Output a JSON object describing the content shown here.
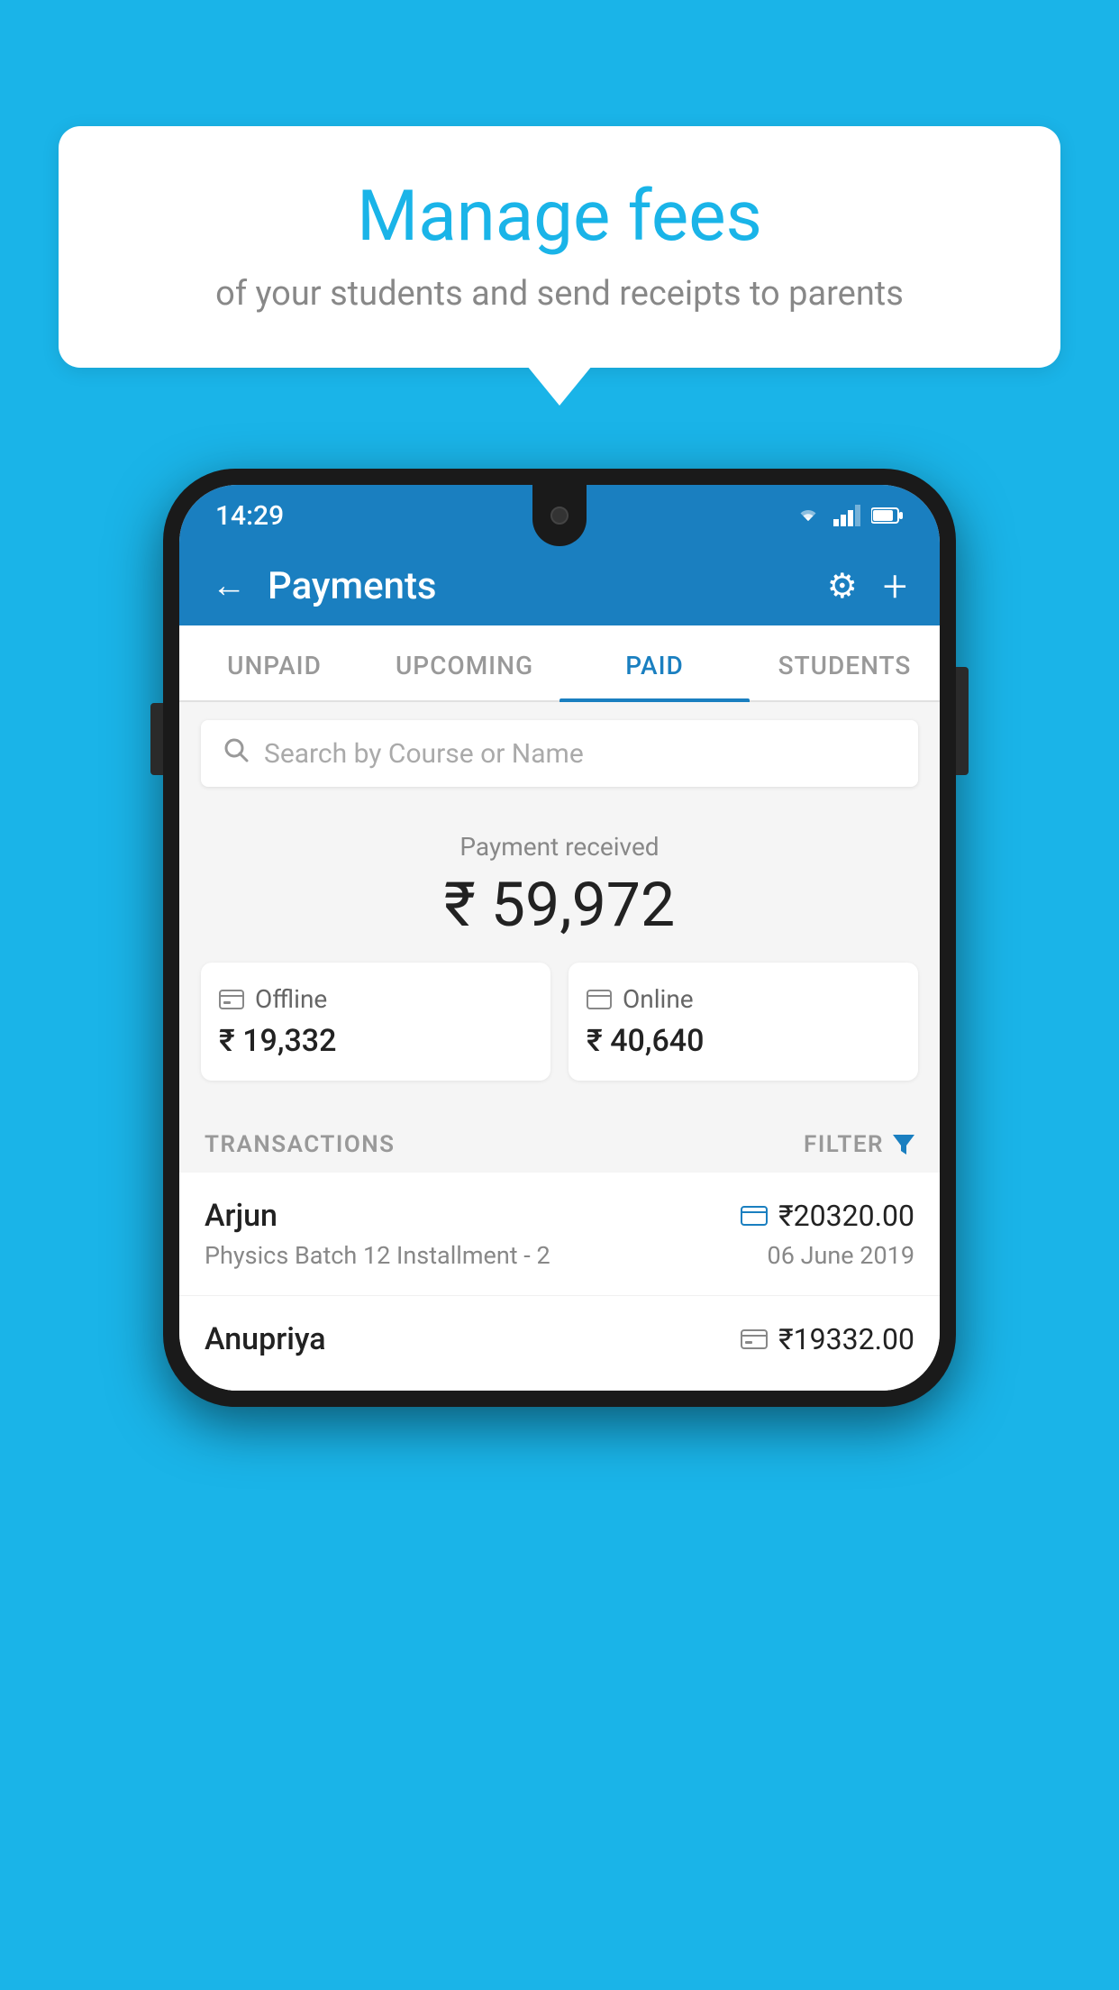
{
  "background_color": "#1ab4e8",
  "speech_bubble": {
    "title": "Manage fees",
    "subtitle": "of your students and send receipts to parents"
  },
  "phone": {
    "status_bar": {
      "time": "14:29",
      "icons": [
        "wifi",
        "signal",
        "battery"
      ]
    },
    "header": {
      "back_label": "←",
      "title": "Payments",
      "gear_icon": "⚙",
      "plus_icon": "+"
    },
    "tabs": [
      {
        "label": "UNPAID",
        "active": false
      },
      {
        "label": "UPCOMING",
        "active": false
      },
      {
        "label": "PAID",
        "active": true
      },
      {
        "label": "STUDENTS",
        "active": false
      }
    ],
    "search": {
      "placeholder": "Search by Course or Name"
    },
    "payment_summary": {
      "label": "Payment received",
      "total": "₹ 59,972",
      "offline": {
        "label": "Offline",
        "amount": "₹ 19,332"
      },
      "online": {
        "label": "Online",
        "amount": "₹ 40,640"
      }
    },
    "transactions_section": {
      "label": "TRANSACTIONS",
      "filter_label": "FILTER"
    },
    "transactions": [
      {
        "name": "Arjun",
        "course": "Physics Batch 12 Installment - 2",
        "amount": "₹20320.00",
        "date": "06 June 2019",
        "type": "online"
      },
      {
        "name": "Anupriya",
        "course": "",
        "amount": "₹19332.00",
        "date": "",
        "type": "offline"
      }
    ]
  }
}
